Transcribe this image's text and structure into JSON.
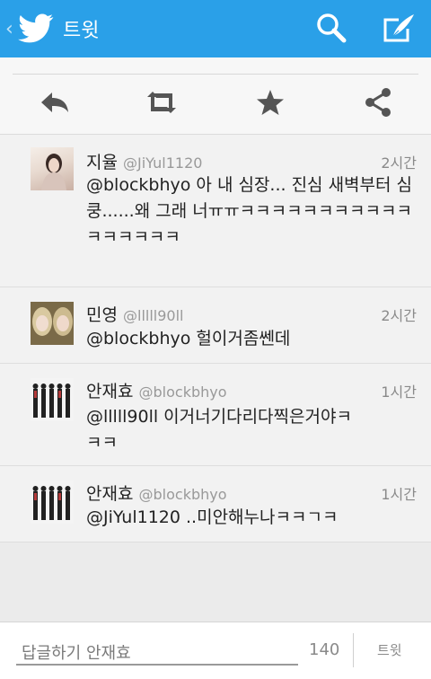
{
  "header": {
    "title": "트윗",
    "back_glyph": "‹",
    "accent": "#2aa0e8"
  },
  "tweets": [
    {
      "name": "지율",
      "handle": "@JiYul1120",
      "time": "2시간",
      "text": "@blockbhyo 아 내 심장... 진심 새벽부터 심쿵......왜 그래 너ㅠㅠㅋㅋㅋㅋㅋㅋㅋㅋㅋㅋㅋㅋㅋㅋㅋㅋㅋ"
    },
    {
      "name": "민영",
      "handle": "@lllll90ll",
      "time": "2시간",
      "text": "@blockbhyo 헐이거좀쎈데"
    },
    {
      "name": "안재효",
      "handle": "@blockbhyo",
      "time": "1시간",
      "text": "@lllll90ll 이거너기다리다찍은거야ㅋㅋㅋ"
    },
    {
      "name": "안재효",
      "handle": "@blockbhyo",
      "time": "1시간",
      "text": "@JiYul1120 ..미안해누나ㅋㅋㄱㅋ"
    }
  ],
  "reply": {
    "placeholder": "답글하기 안재효",
    "char_count": "140",
    "send_label": "트윗"
  }
}
